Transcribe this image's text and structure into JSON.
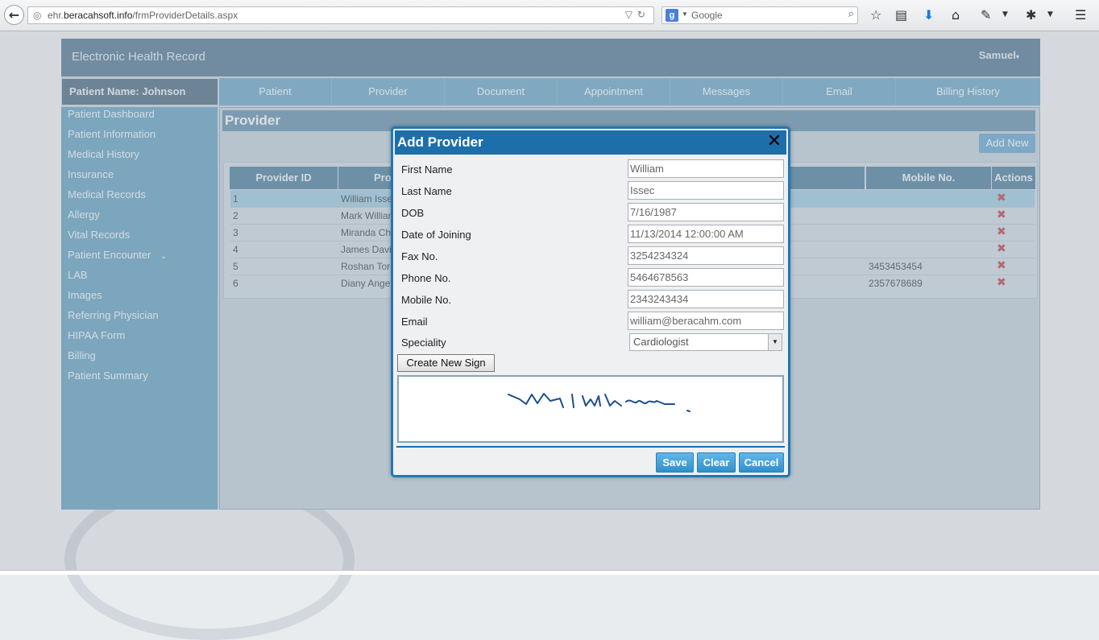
{
  "browser": {
    "url_domain_pre": "ehr.",
    "url_domain_main": "beracahsoft.info",
    "url_path": "/frmProviderDetails.aspx",
    "search_engine_glyph": "g",
    "search_placeholder": "Google",
    "icons": [
      "back-icon",
      "globe-icon",
      "dropdown-icon",
      "reload-icon",
      "search-icon",
      "bookmark-star-icon",
      "reader-icon",
      "download-icon",
      "home-icon",
      "tools-icon",
      "addon-icon",
      "menu-icon"
    ]
  },
  "app": {
    "title": "Electronic Health Record",
    "user": "Samuel",
    "patient_label": "Patient Name: Johnson",
    "tabs": [
      "Patient",
      "Provider",
      "Document",
      "Appointment",
      "Messages",
      "Email",
      "Billing History"
    ],
    "sidebar": [
      "Patient Dashboard",
      "Patient Information",
      "Medical History",
      "Insurance",
      "Medical Records",
      "Allergy",
      "Vital Records",
      "Patient Encounter",
      "LAB",
      "Images",
      "Referring Physician",
      "HIPAA Form",
      "Billing",
      "Patient Summary"
    ],
    "panel_title": "Provider",
    "add_new": "Add New",
    "grid": {
      "headers": {
        "id": "Provider ID",
        "name": "Pro",
        "mobile": "Mobile No.",
        "actions": "Actions"
      },
      "rows": [
        {
          "id": "1",
          "name": "William Isse",
          "mobile": ""
        },
        {
          "id": "2",
          "name": "Mark William",
          "mobile": ""
        },
        {
          "id": "3",
          "name": "Miranda Cha",
          "mobile": ""
        },
        {
          "id": "4",
          "name": "James Davie",
          "mobile": ""
        },
        {
          "id": "5",
          "name": "Roshan Tor",
          "mobile": "3453453454"
        },
        {
          "id": "6",
          "name": "Diany Ange",
          "mobile": "2357678689"
        }
      ]
    }
  },
  "modal": {
    "title": "Add Provider",
    "fields": [
      {
        "label": "First Name",
        "value": "William"
      },
      {
        "label": "Last Name",
        "value": "Issec"
      },
      {
        "label": "DOB",
        "value": "7/16/1987"
      },
      {
        "label": "Date of Joining",
        "value": "11/13/2014 12:00:00 AM"
      },
      {
        "label": "Fax No.",
        "value": "3254234324"
      },
      {
        "label": "Phone No.",
        "value": "5464678563"
      },
      {
        "label": "Mobile No.",
        "value": "2343243434"
      },
      {
        "label": "Email",
        "value": "william@beracahm.com"
      }
    ],
    "speciality_label": "Speciality",
    "speciality_value": "Cardiologist",
    "create_sign": "Create New Sign",
    "signature_text": "William",
    "save": "Save",
    "clear": "Clear",
    "cancel": "Cancel"
  }
}
